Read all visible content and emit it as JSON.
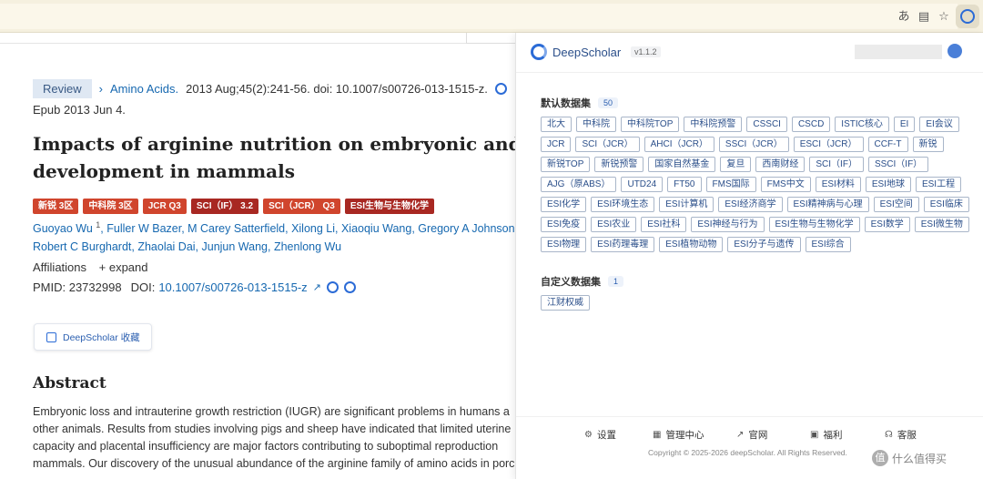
{
  "article": {
    "review_tag": "Review",
    "journal": "Amino Acids.",
    "citation": "2013 Aug;45(2):241-56. doi: 10.1007/s00726-013-1515-z.",
    "epub": "Epub 2013 Jun 4.",
    "title_line1": "Impacts of arginine nutrition on embryonic and fe",
    "title_line2": "development in mammals",
    "badges": [
      {
        "label": "新锐 3区",
        "color": "#d0452d"
      },
      {
        "label": "中科院 3区",
        "color": "#d0452d"
      },
      {
        "label": "JCR Q3",
        "color": "#d0452d"
      },
      {
        "label": "SCI（IF） 3.2",
        "color": "#a82822"
      },
      {
        "label": "SCI（JCR） Q3",
        "color": "#d0452d"
      },
      {
        "label": "ESI生物与生物化学",
        "color": "#a82822"
      }
    ],
    "authors_line1": "Guoyao Wu",
    "author_sup": "1",
    "authors_line1_rest": ", Fuller W Bazer, M Carey Satterfield, Xilong Li, Xiaoqiu Wang, Gregory A Johnson,",
    "authors_line2": "Robert C Burghardt, Zhaolai Dai, Junjun Wang, Zhenlong Wu",
    "affiliations": "Affiliations",
    "expand": "+ expand",
    "pmid": "PMID: 23732998",
    "doi_label": "DOI:",
    "doi": "10.1007/s00726-013-1515-z",
    "collect_button": "DeepScholar 收藏",
    "abstract_heading": "Abstract",
    "abstract_lines": [
      "Embryonic loss and intrauterine growth restriction (IUGR) are significant problems in humans a",
      "other animals. Results from studies involving pigs and sheep have indicated that limited uterine",
      "capacity and placental insufficiency are major factors contributing to suboptimal reproduction",
      "mammals. Our discovery of the unusual abundance of the arginine family of amino acids in porcine"
    ]
  },
  "panel": {
    "brand": "DeepScholar",
    "version": "v1.1.2",
    "default_title": "默认数据集",
    "default_count": "50",
    "default_chips": [
      "北大",
      "中科院",
      "中科院TOP",
      "中科院预警",
      "CSSCI",
      "CSCD",
      "ISTIC核心",
      "EI",
      "EI会议",
      "JCR",
      "SCI（JCR）",
      "AHCI（JCR）",
      "SSCI（JCR）",
      "ESCI（JCR）",
      "CCF-T",
      "新锐",
      "新锐TOP",
      "新锐预警",
      "国家自然基金",
      "复旦",
      "西南财经",
      "SCI（IF）",
      "SSCI（IF）",
      "AJG（原ABS）",
      "UTD24",
      "FT50",
      "FMS国际",
      "FMS中文",
      "ESI材料",
      "ESI地球",
      "ESI工程",
      "ESI化学",
      "ESI环境生态",
      "ESI计算机",
      "ESI经济商学",
      "ESI精神病与心理",
      "ESI空间",
      "ESI临床",
      "ESI免疫",
      "ESI农业",
      "ESI社科",
      "ESI神经与行为",
      "ESI生物与生物化学",
      "ESI数学",
      "ESI微生物",
      "ESI物理",
      "ESI药理毒理",
      "ESI植物动物",
      "ESI分子与遗传",
      "ESI综合"
    ],
    "custom_title": "自定义数据集",
    "custom_count": "1",
    "custom_chips": [
      "江财权威"
    ],
    "footer": [
      {
        "label": "设置",
        "icon": "sliders-icon"
      },
      {
        "label": "管理中心",
        "icon": "grid-icon"
      },
      {
        "label": "官网",
        "icon": "external-link-icon"
      },
      {
        "label": "福利",
        "icon": "gift-icon"
      },
      {
        "label": "客服",
        "icon": "headset-icon"
      }
    ],
    "copyright": "Copyright © 2025-2026 deepScholar. All Rights Reserved."
  },
  "watermark": {
    "icon_text": "值",
    "text": "什么值得买"
  }
}
